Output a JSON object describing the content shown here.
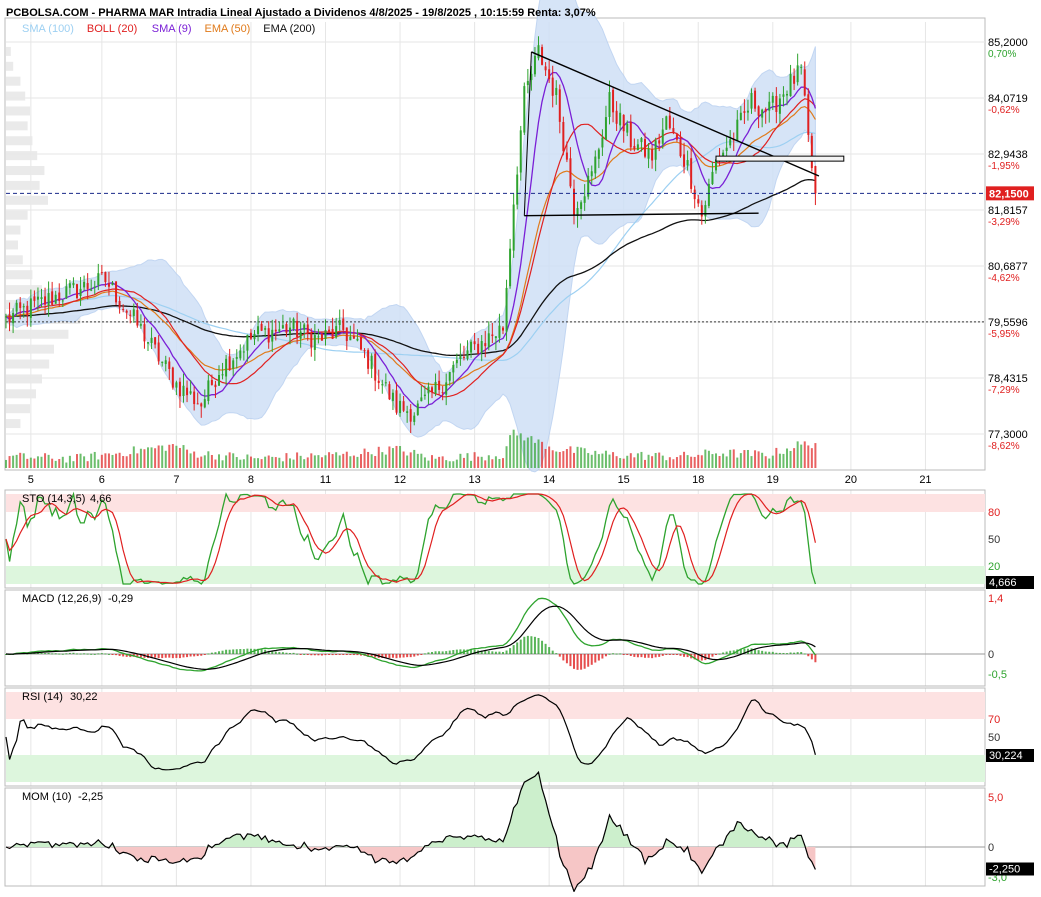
{
  "header": {
    "title": "PCBOLSA.COM - PHARMA MAR Intradia Lineal Ajustado a Dividenos 4/8/2025 - 19/8/2025 , 10:15:59 Renta: 3,07%"
  },
  "legend": [
    {
      "label": "SMA (100)",
      "color": "#9dd0f2"
    },
    {
      "label": "BOLL (20)",
      "color": "#e02020"
    },
    {
      "label": "SMA (9)",
      "color": "#7a1fd6"
    },
    {
      "label": "EMA (50)",
      "color": "#e07a1a"
    },
    {
      "label": "EMA (200)",
      "color": "#111111"
    }
  ],
  "colors": {
    "up": "#2ea32e",
    "down": "#e02020",
    "boll_fill": "#cfe0f6",
    "overbought": "#fde2e2",
    "oversold": "#ddf6dd",
    "grid": "#e6e6e6",
    "price_tag": "#e02020"
  },
  "chart_data": [
    {
      "type": "line",
      "panel": "price",
      "x_ticks": [
        "5",
        "6",
        "7",
        "8",
        "11",
        "12",
        "13",
        "14",
        "15",
        "18",
        "19",
        "20",
        "21"
      ],
      "y_levels": [
        {
          "value": "85,2000",
          "pct": "0,70%",
          "pct_color": "#2ea32e"
        },
        {
          "value": "84,0719",
          "pct": "-0,62%",
          "pct_color": "#e02020"
        },
        {
          "value": "82,9438",
          "pct": "-1,95%",
          "pct_color": "#e02020"
        },
        {
          "value": "81,8157",
          "pct": "-3,29%",
          "pct_color": "#e02020"
        },
        {
          "value": "80,6877",
          "pct": "-4,62%",
          "pct_color": "#e02020"
        },
        {
          "value": "79,5596",
          "pct": "-5,95%",
          "pct_color": "#e02020"
        },
        {
          "value": "78,4315",
          "pct": "-7,29%",
          "pct_color": "#e02020"
        },
        {
          "value": "77,3000",
          "pct": "-8,62%",
          "pct_color": "#e02020"
        }
      ],
      "ylim": [
        77.3,
        85.2
      ],
      "last_price": {
        "label": "82,1500",
        "value": 82.15
      },
      "reference_level": 79.56,
      "close_anchors": [
        [
          0,
          79.6
        ],
        [
          5,
          79.8
        ],
        [
          15,
          80.1
        ],
        [
          28,
          80.4
        ],
        [
          38,
          79.4
        ],
        [
          48,
          78.3
        ],
        [
          55,
          77.9
        ],
        [
          60,
          78.6
        ],
        [
          70,
          79.3
        ],
        [
          80,
          79.45
        ],
        [
          88,
          79.2
        ],
        [
          95,
          79.4
        ],
        [
          102,
          78.8
        ],
        [
          110,
          77.85
        ],
        [
          115,
          77.75
        ],
        [
          120,
          78.1
        ],
        [
          128,
          78.8
        ],
        [
          135,
          79.2
        ],
        [
          140,
          79.45
        ],
        [
          143,
          82.0
        ],
        [
          146,
          84.1
        ],
        [
          150,
          85.0
        ],
        [
          155,
          84.1
        ],
        [
          160,
          81.9
        ],
        [
          165,
          82.5
        ],
        [
          170,
          84.0
        ],
        [
          176,
          83.2
        ],
        [
          182,
          82.9
        ],
        [
          186,
          83.6
        ],
        [
          192,
          82.7
        ],
        [
          196,
          81.7
        ],
        [
          200,
          82.8
        ],
        [
          205,
          83.3
        ],
        [
          210,
          84.0
        ],
        [
          215,
          83.8
        ],
        [
          220,
          84.3
        ],
        [
          224,
          84.6
        ],
        [
          226,
          83.2
        ],
        [
          228,
          82.15
        ]
      ],
      "volume_anchors": [
        [
          0,
          0.25
        ],
        [
          20,
          0.2
        ],
        [
          48,
          0.55
        ],
        [
          52,
          0.35
        ],
        [
          70,
          0.2
        ],
        [
          95,
          0.3
        ],
        [
          110,
          0.45
        ],
        [
          120,
          0.2
        ],
        [
          140,
          0.3
        ],
        [
          143,
          0.9
        ],
        [
          148,
          0.7
        ],
        [
          155,
          0.45
        ],
        [
          170,
          0.3
        ],
        [
          190,
          0.25
        ],
        [
          200,
          0.35
        ],
        [
          215,
          0.3
        ],
        [
          223,
          0.55
        ],
        [
          228,
          0.6
        ]
      ],
      "triangle": {
        "apex": [
          148,
          85.0
        ],
        "upper_end": [
          229,
          82.5
        ],
        "base_start": [
          146,
          81.7
        ],
        "base_end": [
          212,
          81.75
        ]
      },
      "rectangle": {
        "x": [
          200,
          236
        ],
        "y": [
          82.8,
          82.9
        ]
      },
      "volume_profile": [
        [
          85.0,
          0.04
        ],
        [
          84.7,
          0.06
        ],
        [
          84.4,
          0.12
        ],
        [
          84.1,
          0.16
        ],
        [
          83.8,
          0.2
        ],
        [
          83.5,
          0.18
        ],
        [
          83.2,
          0.22
        ],
        [
          82.9,
          0.26
        ],
        [
          82.6,
          0.32
        ],
        [
          82.3,
          0.28
        ],
        [
          82.0,
          0.35
        ],
        [
          81.7,
          0.18
        ],
        [
          81.4,
          0.12
        ],
        [
          81.1,
          0.1
        ],
        [
          80.8,
          0.14
        ],
        [
          80.5,
          0.22
        ],
        [
          80.2,
          0.3
        ],
        [
          79.9,
          0.4
        ],
        [
          79.6,
          0.62
        ],
        [
          79.3,
          0.52
        ],
        [
          79.0,
          0.4
        ],
        [
          78.7,
          0.36
        ],
        [
          78.4,
          0.3
        ],
        [
          78.1,
          0.25
        ],
        [
          77.8,
          0.2
        ],
        [
          77.5,
          0.12
        ]
      ]
    },
    {
      "type": "line",
      "panel": "stochastic",
      "title": "STO (14,3,5)",
      "value_label": "4,66",
      "current_label": "4,666",
      "ylim": [
        0,
        100
      ],
      "levels": [
        {
          "value": 80,
          "label": "80",
          "color": "#e02020"
        },
        {
          "value": 50,
          "label": "50",
          "color": "#333333"
        },
        {
          "value": 20,
          "label": "20",
          "color": "#2ea32e"
        }
      ]
    },
    {
      "type": "line",
      "panel": "macd",
      "title": "MACD (12,26,9)",
      "value_label": "-0,29",
      "ylim": [
        -0.7,
        1.5
      ],
      "levels": [
        {
          "value": 1.4,
          "label": "1,4",
          "color": "#e02020"
        },
        {
          "value": 0,
          "label": "0",
          "color": "#333333"
        },
        {
          "value": -0.5,
          "label": "-0,5",
          "color": "#2ea32e"
        }
      ]
    },
    {
      "type": "line",
      "panel": "rsi",
      "title": "RSI (14)",
      "value_label": "30,22",
      "current_label": "30,224",
      "ylim": [
        0,
        100
      ],
      "levels": [
        {
          "value": 70,
          "label": "70",
          "color": "#e02020"
        },
        {
          "value": 50,
          "label": "50",
          "color": "#333333"
        }
      ]
    },
    {
      "type": "line",
      "panel": "momentum",
      "title": "MOM (10)",
      "value_label": "-2,25",
      "current_label": "-2,250",
      "ylim": [
        -3.5,
        5.5
      ],
      "levels": [
        {
          "value": 5.0,
          "label": "5,0",
          "color": "#e02020"
        },
        {
          "value": 0,
          "label": "0",
          "color": "#333333"
        },
        {
          "value": -3.0,
          "label": "-3,0",
          "color": "#2ea32e"
        }
      ]
    }
  ]
}
